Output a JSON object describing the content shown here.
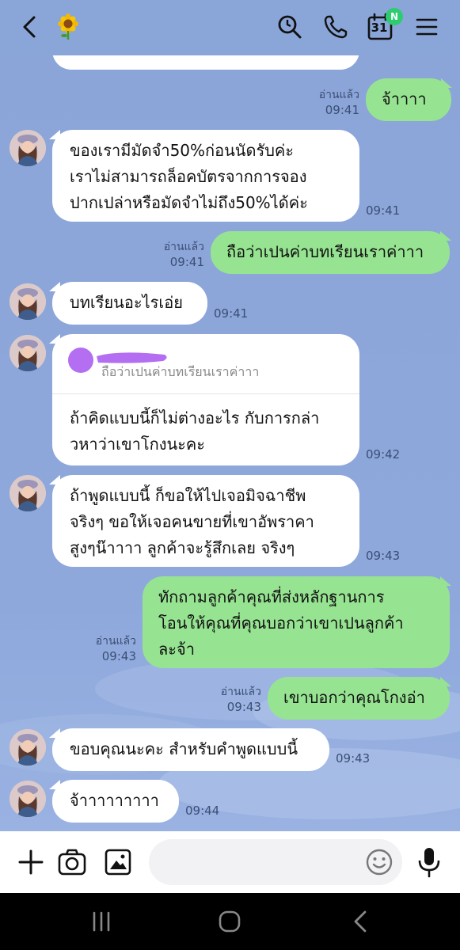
{
  "header": {
    "chat_icon": "sunflower-icon",
    "calendar_day": "31",
    "calendar_badge": "N"
  },
  "colors": {
    "background": "#8aa5d8",
    "incoming_bubble": "#ffffff",
    "outgoing_bubble": "#96e391",
    "badge": "#2ecc71"
  },
  "messages": [
    {
      "sender": "me",
      "text": "จ้าาาา",
      "read": "อ่านแล้ว",
      "time": "09:41"
    },
    {
      "sender": "them",
      "lines": [
        "ของเรามีมัดจำ50%ก่อนนัดรับค่ะ",
        "เราไม่สามารถล็อคบัตรจากการจอง",
        "ปากเปล่าหรือมัดจำไม่ถึง50%ได้ค่ะ"
      ],
      "time": "09:41"
    },
    {
      "sender": "me",
      "text": "ถือว่าเปนค่าบทเรียนเราค่าาา",
      "read": "อ่านแล้ว",
      "time": "09:41"
    },
    {
      "sender": "them",
      "text": "บทเรียนอะไรเอ่ย",
      "time": "09:41"
    },
    {
      "sender": "them",
      "reply_quote": "ถือว่าเปนค่าบทเรียนเราค่าาา",
      "lines": [
        "ถ้าคิดแบบนี้ก็ไม่ต่างอะไร กับการกล่า",
        "วหาว่าเขาโกงนะคะ"
      ],
      "time": "09:42"
    },
    {
      "sender": "them",
      "lines": [
        "ถ้าพูดแบบนี้ ก็ขอให้ไปเจอมิจฉาชีพ",
        "จริงๆ ขอให้เจอคนขายที่เขาอัพราคา",
        "สูงๆน๊าาาา ลูกค้าจะรู้สึกเลย จริงๆ"
      ],
      "time": "09:43"
    },
    {
      "sender": "me",
      "lines": [
        "ทักถามลูกค้าคุณที่ส่งหลักฐานการ",
        "โอนให้คุณที่คุณบอกว่าเขาเปนลูกค้า",
        "ละจ้า"
      ],
      "read": "อ่านแล้ว",
      "time": "09:43"
    },
    {
      "sender": "me",
      "text": "เขาบอกว่าคุณโกงอ่า",
      "read": "อ่านแล้ว",
      "time": "09:43"
    },
    {
      "sender": "them",
      "text": "ขอบคุณนะคะ สำหรับคำพูดแบบนี้",
      "time": "09:43"
    },
    {
      "sender": "them",
      "text": "จ้าาาาาาาาา",
      "time": "09:44"
    }
  ],
  "input": {
    "placeholder": ""
  }
}
